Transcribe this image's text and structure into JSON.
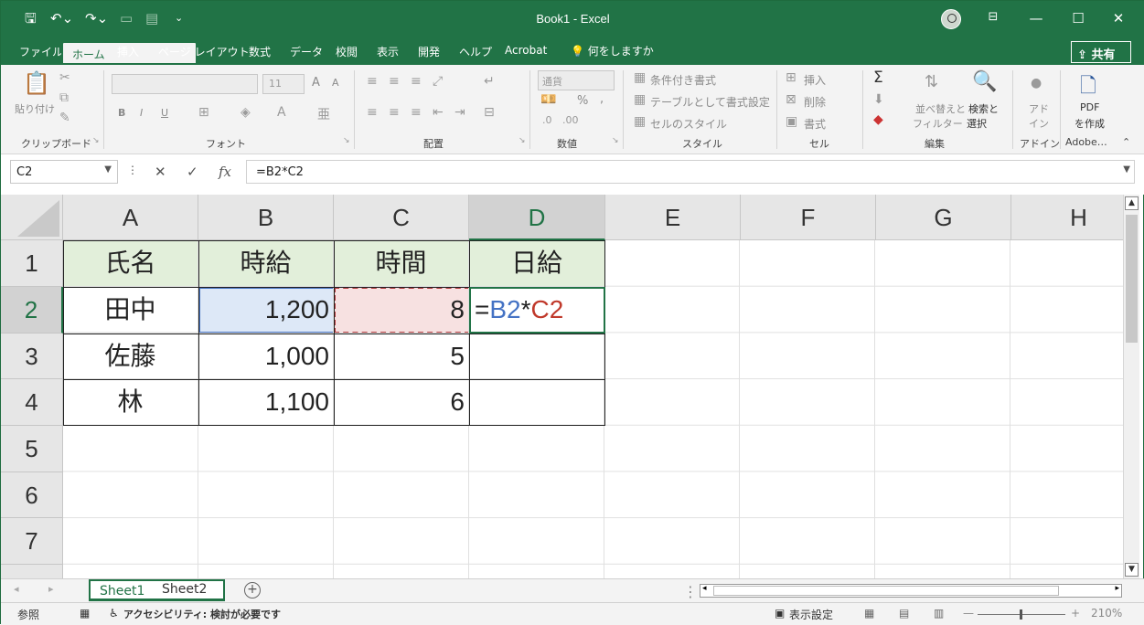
{
  "window": {
    "title": "Book1  -  Excel",
    "accent_color": "#217346"
  },
  "quick_access": {
    "save_icon": "save-icon",
    "undo_icon": "undo-icon",
    "redo_icon": "redo-icon"
  },
  "menu": {
    "tabs": [
      "ファイル",
      "ホーム",
      "挿入",
      "ページ レイアウト",
      "数式",
      "データ",
      "校閲",
      "表示",
      "開発",
      "ヘルプ",
      "Acrobat"
    ],
    "active_tab": "ホーム",
    "tell_me": "何をしますか",
    "share": "共有"
  },
  "ribbon": {
    "groups": {
      "clipboard": "クリップボード",
      "font": "フォント",
      "alignment": "配置",
      "number": "数値",
      "styles": "スタイル",
      "cells": "セル",
      "editing": "編集",
      "addins": "アドイン",
      "adobe": "Adobe…"
    },
    "clipboard": {
      "paste": "貼り付け"
    },
    "font": {
      "size": "11",
      "bold": "B",
      "italic": "I",
      "underline": "U",
      "grow": "A",
      "shrink": "A"
    },
    "number": {
      "format": "通貨",
      "percent": "%",
      "comma": ","
    },
    "styles": {
      "conditional": "条件付き書式",
      "as_table": "テーブルとして書式設定",
      "cell_styles": "セルのスタイル"
    },
    "cells": {
      "insert": "挿入",
      "delete": "削除",
      "format": "書式"
    },
    "editing": {
      "sum": "Σ",
      "sort": "並べ替えと\nフィルター",
      "sort_line1": "並べ替えと",
      "sort_line2": "フィルター",
      "find_line1": "検索と",
      "find_line2": "選択"
    },
    "addins": {
      "line1": "アド",
      "line2": "イン"
    },
    "adobe": {
      "line1": "PDF",
      "line2": "を作成"
    }
  },
  "formula_bar": {
    "name_box": "C2",
    "formula": "=B2*C2"
  },
  "sheet": {
    "columns": [
      "A",
      "B",
      "C",
      "D",
      "E",
      "F",
      "G",
      "H"
    ],
    "rows": [
      "1",
      "2",
      "3",
      "4",
      "5",
      "6",
      "7"
    ],
    "cells": {
      "A1": "氏名",
      "B1": "時給",
      "C1": "時間",
      "D1": "日給",
      "A2": "田中",
      "B2": "1,200",
      "C2": "8",
      "A3": "佐藤",
      "B3": "1,000",
      "C3": "5",
      "A4": "林",
      "B4": "1,100",
      "C4": "6"
    },
    "edit_formula": {
      "eq": "=",
      "ref1": "B2",
      "op": "*",
      "ref2": "C2"
    },
    "header_fill": "#e2efda"
  },
  "sheet_tabs": [
    "Sheet1",
    "Sheet2"
  ],
  "status": {
    "mode": "参照",
    "accessibility": "アクセシビリティ: 検討が必要です",
    "display_settings": "表示設定",
    "zoom": "210%"
  }
}
